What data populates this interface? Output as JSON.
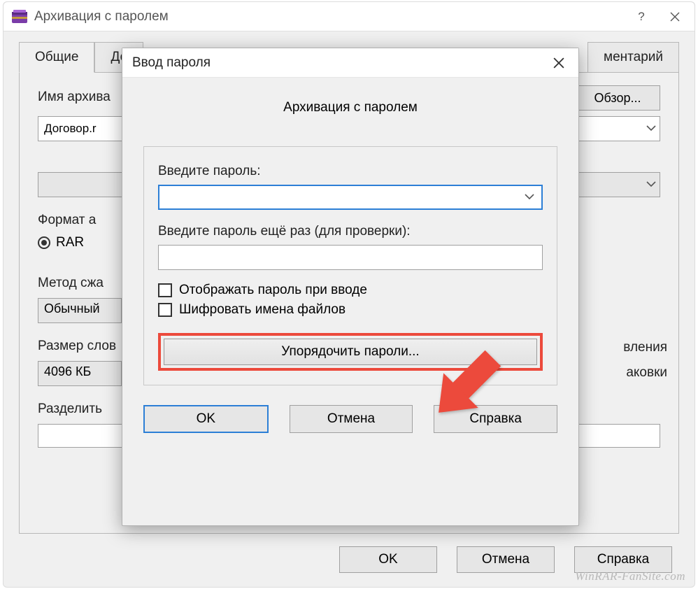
{
  "main": {
    "title": "Архивация с паролем",
    "tabs": {
      "general": "Общие",
      "advanced_stub": "До",
      "comment_stub": "ментарий"
    },
    "archive_name_label": "Имя архива",
    "archive_name_value": "Договор.r",
    "browse": "Обзор...",
    "format_label": "Формат а",
    "format_rar": "RAR",
    "method_label": "Метод сжа",
    "method_value": "Обычный",
    "dict_label": "Размер слов",
    "dict_value": "4096 КБ",
    "split_label": "Разделить",
    "peek_update": "вления",
    "peek_pack": "аковки",
    "footer": {
      "ok": "OK",
      "cancel": "Отмена",
      "help": "Справка"
    }
  },
  "modal": {
    "title": "Ввод пароля",
    "heading": "Архивация с паролем",
    "enter_pw": "Введите пароль:",
    "confirm_pw": "Введите пароль ещё раз (для проверки):",
    "show_pw": "Отображать пароль при вводе",
    "encrypt_names": "Шифровать имена файлов",
    "organize": "Упорядочить пароли...",
    "ok": "OK",
    "cancel": "Отмена",
    "help": "Справка"
  },
  "watermark": "WinRAR-FanSite.com"
}
